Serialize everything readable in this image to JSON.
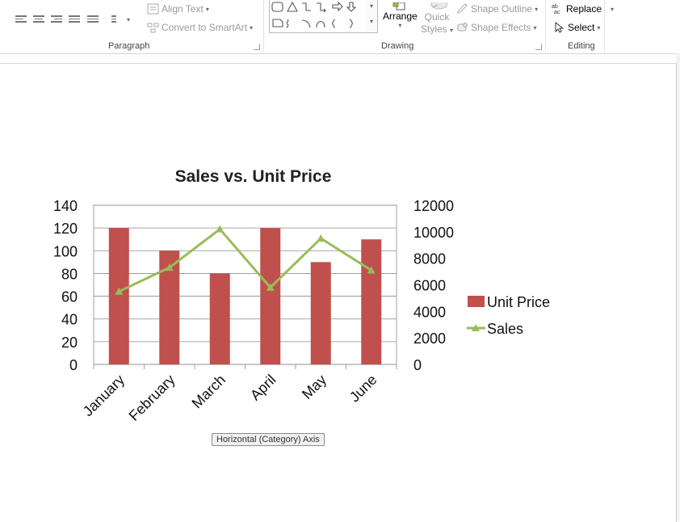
{
  "ribbon": {
    "paragraph": {
      "label": "Paragraph",
      "align_text_label": "Align Text",
      "convert_smartart_label": "Convert to SmartArt"
    },
    "drawing": {
      "label": "Drawing",
      "arrange_label": "Arrange",
      "quick_styles_line1": "Quick",
      "quick_styles_line2": "Styles",
      "shape_outline_label": "Shape Outline",
      "shape_effects_label": "Shape Effects"
    },
    "editing": {
      "label": "Editing",
      "replace_label": "Replace",
      "select_label": "Select"
    }
  },
  "chart_tooltip": "Horizontal (Category) Axis",
  "chart_data": {
    "type": "bar",
    "title": "Sales vs. Unit Price",
    "categories": [
      "January",
      "February",
      "March",
      "April",
      "May",
      "June"
    ],
    "series": [
      {
        "name": "Unit Price",
        "type": "bar",
        "axis": "left",
        "color": "#c0504d",
        "values": [
          120,
          100,
          80,
          120,
          90,
          110
        ]
      },
      {
        "name": "Sales",
        "type": "line",
        "axis": "right",
        "color": "#9bbb59",
        "marker": "triangle",
        "values": [
          5500,
          7300,
          10200,
          5800,
          9500,
          7100
        ]
      }
    ],
    "ylim_left": [
      0,
      140
    ],
    "yticks_left": [
      0,
      20,
      40,
      60,
      80,
      100,
      120,
      140
    ],
    "ylim_right": [
      0,
      12000
    ],
    "yticks_right": [
      0,
      2000,
      4000,
      6000,
      8000,
      10000,
      12000
    ],
    "grid": true,
    "legend": "right"
  }
}
